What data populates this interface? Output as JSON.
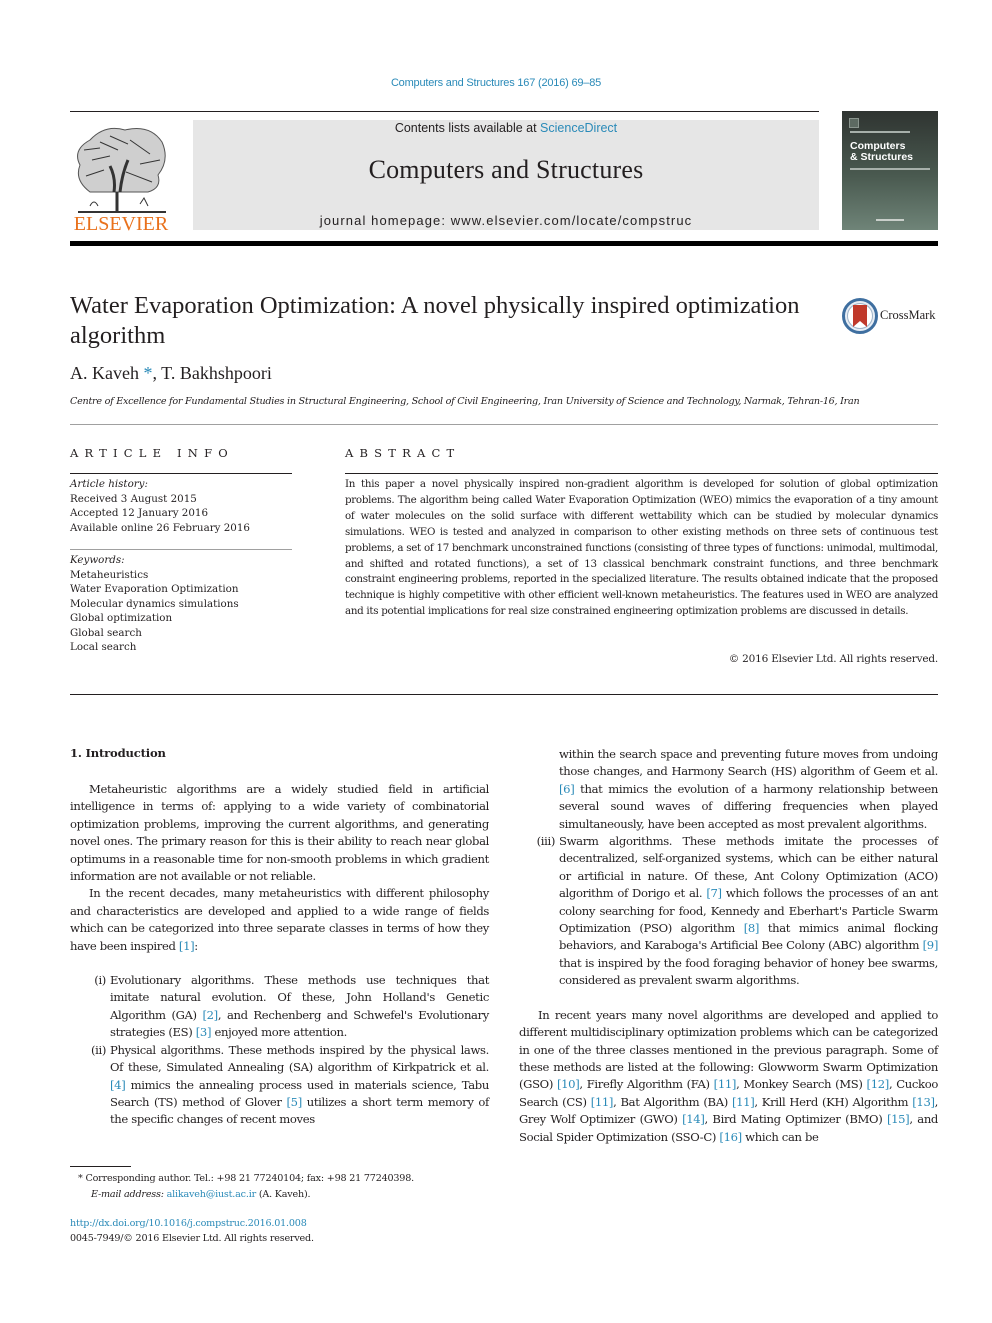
{
  "header": {
    "citation": "Computers and Structures 167 (2016) 69–85",
    "contents_prefix": "Contents lists available at ",
    "contents_link": "ScienceDirect",
    "journal_title": "Computers and Structures",
    "homepage": "journal homepage: www.elsevier.com/locate/compstruc",
    "publisher_logo_text": "ELSEVIER",
    "cover": {
      "title_line1": "Computers",
      "title_line2": "& Structures"
    }
  },
  "article": {
    "title": "Water Evaporation Optimization: A novel physically inspired optimization algorithm",
    "crossmark_label": "CrossMark",
    "authors": [
      {
        "name": "A. Kaveh",
        "marker": "*"
      },
      {
        "name": "T. Bakhshpoori",
        "marker": ""
      }
    ],
    "author_separator": ", ",
    "affiliation": "Centre of Excellence for Fundamental Studies in Structural Engineering, School of Civil Engineering, Iran University of Science and Technology, Narmak, Tehran-16, Iran"
  },
  "article_info": {
    "heading": "ARTICLE INFO",
    "history_label": "Article history:",
    "history": [
      "Received 3 August 2015",
      "Accepted 12 January 2016",
      "Available online 26 February 2016"
    ],
    "keywords_label": "Keywords:",
    "keywords": [
      "Metaheuristics",
      "Water Evaporation Optimization",
      "Molecular dynamics simulations",
      "Global optimization",
      "Global search",
      "Local search"
    ]
  },
  "abstract": {
    "heading": "ABSTRACT",
    "text": "In this paper a novel physically inspired non-gradient algorithm is developed for solution of global optimization problems. The algorithm being called Water Evaporation Optimization (WEO) mimics the evaporation of a tiny amount of water molecules on the solid surface with different wettability which can be studied by molecular dynamics simulations. WEO is tested and analyzed in comparison to other existing methods on three sets of continuous test problems, a set of 17 benchmark unconstrained functions (consisting of three types of functions: unimodal, multimodal, and shifted and rotated functions), a set of 13 classical benchmark constraint functions, and three benchmark constraint engineering problems, reported in the specialized literature. The results obtained indicate that the proposed technique is highly competitive with other efficient well-known metaheuristics. The features used in WEO are analyzed and its potential implications for real size constrained engineering optimization problems are discussed in details.",
    "copyright": "© 2016 Elsevier Ltd. All rights reserved."
  },
  "body": {
    "section_heading": "1. Introduction",
    "para1": "Metaheuristic algorithms are a widely studied field in artificial intelligence in terms of: applying to a wide variety of combinatorial optimization problems, improving the current algorithms, and generating novel ones. The primary reason for this is their ability to reach near global optimums in a reasonable time for non-smooth problems in which gradient information are not available or not reliable.",
    "para2_text": "In the recent decades, many metaheuristics with different philosophy and characteristics are developed and applied to a wide range of fields which can be categorized into three separate classes in terms of how they have been inspired ",
    "para2_ref": "[1]",
    "para2_end": ":",
    "list": [
      {
        "num": "(i)",
        "segments": [
          {
            "t": "Evolutionary algorithms. These methods use techniques that imitate natural evolution. Of these, John Holland's Genetic Algorithm (GA) "
          },
          {
            "r": "[2]"
          },
          {
            "t": ", and Rechenberg and Schwefel's Evolutionary strategies (ES) "
          },
          {
            "r": "[3]"
          },
          {
            "t": " enjoyed more attention."
          }
        ]
      },
      {
        "num": "(ii)",
        "segments": [
          {
            "t": "Physical algorithms. These methods inspired by the physical laws. Of these, Simulated Annealing (SA) algorithm of Kirkpatrick et al. "
          },
          {
            "r": "[4]"
          },
          {
            "t": " mimics the annealing process used in materials science, Tabu Search (TS) method of Glover "
          },
          {
            "r": "[5]"
          },
          {
            "t": " utilizes a short term memory of the specific changes of recent moves"
          }
        ]
      }
    ],
    "list_continued": [
      {
        "t": "within the search space and preventing future moves from undoing those changes, and Harmony Search (HS) algorithm of Geem et al. "
      },
      {
        "r": "[6]"
      },
      {
        "t": " that mimics the evolution of a harmony relationship between several sound waves of differing frequencies when played simultaneously, have been accepted as most prevalent algorithms."
      }
    ],
    "list_item3": {
      "num": "(iii)",
      "segments": [
        {
          "t": "Swarm algorithms. These methods imitate the processes of decentralized, self-organized systems, which can be either natural or artificial in nature. Of these, Ant Colony Optimization (ACO) algorithm of Dorigo et al. "
        },
        {
          "r": "[7]"
        },
        {
          "t": " which follows the processes of an ant colony searching for food, Kennedy and Eberhart's Particle Swarm Optimization (PSO) algorithm "
        },
        {
          "r": "[8]"
        },
        {
          "t": " that mimics animal flocking behaviors, and Karaboga's Artificial Bee Colony (ABC) algorithm "
        },
        {
          "r": "[9]"
        },
        {
          "t": " that is inspired by the food foraging behavior of honey bee swarms, considered as prevalent swarm algorithms."
        }
      ]
    },
    "para3": [
      {
        "t": "In recent years many novel algorithms are developed and applied to different multidisciplinary optimization problems which can be categorized in one of the three classes mentioned in the previous paragraph. Some of these methods are listed at the following: Glowworm Swarm Optimization (GSO) "
      },
      {
        "r": "[10]"
      },
      {
        "t": ", Firefly Algorithm (FA) "
      },
      {
        "r": "[11]"
      },
      {
        "t": ", Monkey Search (MS) "
      },
      {
        "r": "[12]"
      },
      {
        "t": ", Cuckoo Search (CS) "
      },
      {
        "r": "[11]"
      },
      {
        "t": ", Bat Algorithm (BA) "
      },
      {
        "r": "[11]"
      },
      {
        "t": ", Krill Herd (KH) Algorithm "
      },
      {
        "r": "[13]"
      },
      {
        "t": ", Grey Wolf Optimizer (GWO) "
      },
      {
        "r": "[14]"
      },
      {
        "t": ", Bird Mating Optimizer (BMO) "
      },
      {
        "r": "[15]"
      },
      {
        "t": ", and Social Spider Optimization (SSO-C) "
      },
      {
        "r": "[16]"
      },
      {
        "t": " which can be"
      }
    ]
  },
  "footnote": {
    "marker": "*",
    "text": "Corresponding author. Tel.: +98 21 77240104; fax: +98 21 77240398.",
    "email_label": "E-mail address: ",
    "email": "alikaveh@iust.ac.ir",
    "email_suffix": " (A. Kaveh).",
    "doi": "http://dx.doi.org/10.1016/j.compstruc.2016.01.008",
    "issn_copyright": "0045-7949/© 2016 Elsevier Ltd. All rights reserved."
  },
  "colors": {
    "link": "#2a8ab8",
    "text": "#231f20",
    "header_band": "#e6e6e6",
    "elsevier_orange": "#e9711c",
    "crossmark_red": "#c0392b",
    "crossmark_blue": "#3f6fa0"
  }
}
